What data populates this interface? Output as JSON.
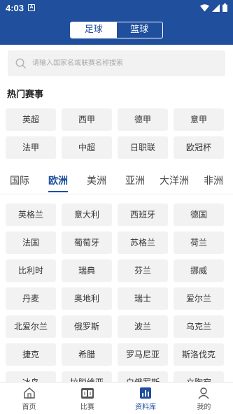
{
  "status": {
    "time": "4:03",
    "notif_glyph": "A"
  },
  "sport_toggle": {
    "football": "足球",
    "basketball": "篮球"
  },
  "search": {
    "placeholder": "请输入国家名或联赛名称搜索"
  },
  "hot": {
    "title": "热门赛事",
    "items": [
      "英超",
      "西甲",
      "德甲",
      "意甲",
      "法甲",
      "中超",
      "日职联",
      "欧冠杯"
    ]
  },
  "tabs": [
    "国际",
    "欧洲",
    "美洲",
    "亚洲",
    "大洋洲",
    "非洲"
  ],
  "active_tab": "欧洲",
  "countries": [
    "英格兰",
    "意大利",
    "西班牙",
    "德国",
    "法国",
    "葡萄牙",
    "苏格兰",
    "荷兰",
    "比利时",
    "瑞典",
    "芬兰",
    "挪威",
    "丹麦",
    "奥地利",
    "瑞士",
    "爱尔兰",
    "北爱尔兰",
    "俄罗斯",
    "波兰",
    "乌克兰",
    "捷克",
    "希腊",
    "罗马尼亚",
    "斯洛伐克",
    "冰岛",
    "拉脱维亚",
    "白俄罗斯",
    "立陶宛"
  ],
  "bottom_nav": [
    {
      "label": "首页",
      "icon": "home-icon"
    },
    {
      "label": "比赛",
      "icon": "scoreboard-icon"
    },
    {
      "label": "资料库",
      "icon": "database-chart-icon"
    },
    {
      "label": "我的",
      "icon": "user-icon"
    }
  ],
  "colors": {
    "primary": "#1f4f9d",
    "chip_bg": "#f2f2f2"
  }
}
